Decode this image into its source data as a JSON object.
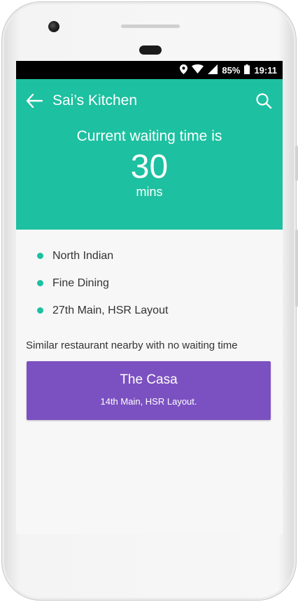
{
  "status_bar": {
    "battery": "85%",
    "time": "19:11"
  },
  "header": {
    "title": "Sai’s Kitchen",
    "waiting_label": "Current waiting time is",
    "waiting_value": "30",
    "waiting_unit": "mins"
  },
  "details": {
    "tags": [
      "North Indian",
      "Fine Dining",
      "27th Main, HSR Layout"
    ]
  },
  "similar": {
    "label": "Similar restaurant nearby with no waiting time",
    "restaurant": {
      "name": "The Casa",
      "address": "14th Main, HSR Layout."
    }
  },
  "colors": {
    "primary": "#1dc0a0",
    "suggestion": "#7b51c1"
  }
}
